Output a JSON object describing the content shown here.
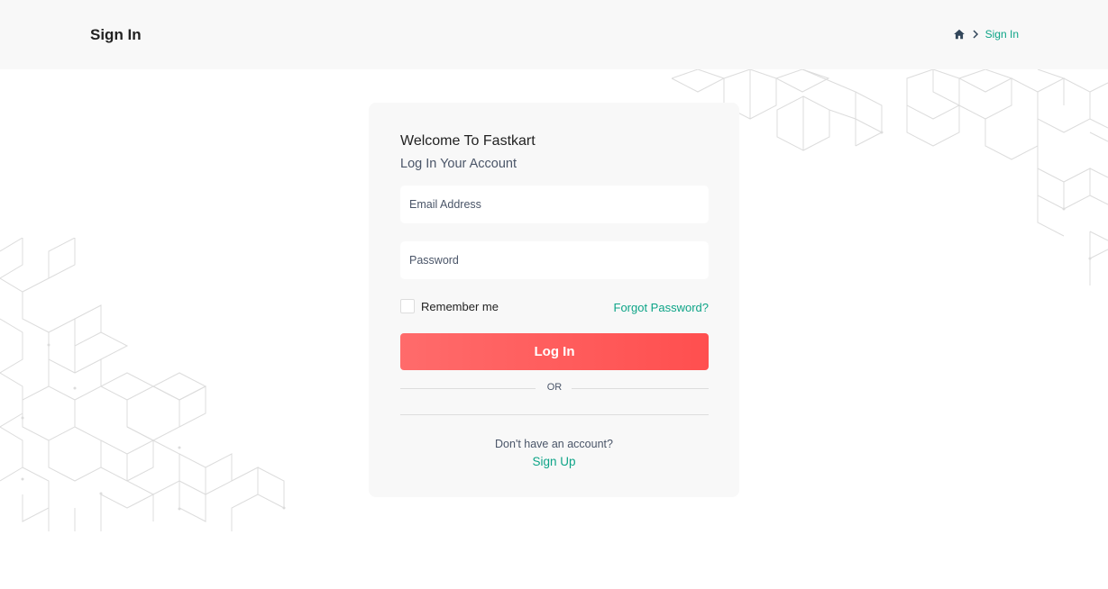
{
  "header": {
    "title": "Sign In",
    "breadcrumb": {
      "home_icon": "home-icon",
      "separator_icon": "chevron-right-icon",
      "current": "Sign In"
    }
  },
  "card": {
    "welcome": "Welcome To Fastkart",
    "subtitle": "Log In Your Account",
    "email": {
      "value": "",
      "placeholder": "Email Address"
    },
    "password": {
      "value": "",
      "placeholder": "Password"
    },
    "remember_label": "Remember me",
    "remember_checked": false,
    "forgot_label": "Forgot Password?",
    "login_label": "Log In",
    "or_label": "OR",
    "signup_prompt": "Don't have an account?",
    "signup_label": "Sign Up"
  },
  "colors": {
    "accent": "#0da487",
    "button_start": "#ff6b6b",
    "button_end": "#ff4f4f",
    "header_bg": "#f8f8f8",
    "card_bg": "#f8f8f8"
  }
}
